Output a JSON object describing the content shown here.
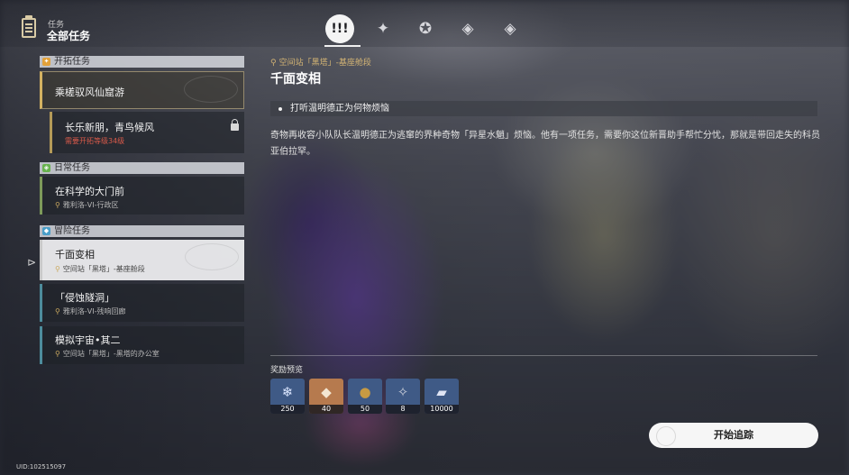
{
  "header": {
    "small_label": "任务",
    "title": "全部任务"
  },
  "tabs": [
    {
      "icon": "exclamation-icon",
      "glyph": "!!!",
      "active": true
    },
    {
      "icon": "trailblaze-diamond-icon",
      "glyph": "✦",
      "active": false
    },
    {
      "icon": "star-circle-icon",
      "glyph": "✪",
      "active": false
    },
    {
      "icon": "diamond-check-icon",
      "glyph": "◈",
      "active": false
    },
    {
      "icon": "diamond-plus-icon",
      "glyph": "◈",
      "active": false
    }
  ],
  "sections": [
    {
      "title": "开拓任务",
      "color": "#e2a13a",
      "items": [
        {
          "title": "乘槎驭风仙窟游",
          "subtitle": "",
          "locked": false
        },
        {
          "title": "长乐新朋，青鸟候风",
          "subtitle": "需要开拓等级34级",
          "locked": true
        }
      ]
    },
    {
      "title": "日常任务",
      "color": "#67b24e",
      "items": [
        {
          "title": "在科学的大门前",
          "subtitle": "雅利洛-VI-行政区",
          "locked": false
        }
      ]
    },
    {
      "title": "冒险任务",
      "color": "#4a9ec9",
      "items": [
        {
          "title": "千面变相",
          "subtitle": "空间站「黑塔」-基座舱段",
          "selected": true
        },
        {
          "title": "「侵蚀隧洞」",
          "subtitle": "雅利洛-VI-残响回廊"
        },
        {
          "title": "模拟宇宙•其二",
          "subtitle": "空间站「黑塔」-黑塔的办公室"
        }
      ]
    }
  ],
  "detail": {
    "location": "空间站「黑塔」-基座舱段",
    "title": "千面变相",
    "objective": "打听温明德正为何物烦恼",
    "description": "奇物再收容小队队长温明德正为逃窜的界种奇物「异星水魈」烦恼。他有一项任务，需要你这位新晋助手帮忙分忧，那就是带回走失的科员亚伯拉罕。",
    "rewards_label": "奖励预览",
    "rewards": [
      {
        "icon": "stellar-jade-icon",
        "glyph": "❄",
        "qty": "250",
        "bg": "#3f5a86"
      },
      {
        "icon": "crystal-icon",
        "glyph": "◆",
        "qty": "40",
        "bg": "#b67a4e"
      },
      {
        "icon": "coin-icon",
        "glyph": "●",
        "qty": "50",
        "bg": "#3f5a86"
      },
      {
        "icon": "material-icon",
        "glyph": "✧",
        "qty": "8",
        "bg": "#3f5a86"
      },
      {
        "icon": "credit-icon",
        "glyph": "▰",
        "qty": "10000",
        "bg": "#3f5a86"
      }
    ],
    "track_button": "开始追踪"
  },
  "uid": "UID:102515097"
}
